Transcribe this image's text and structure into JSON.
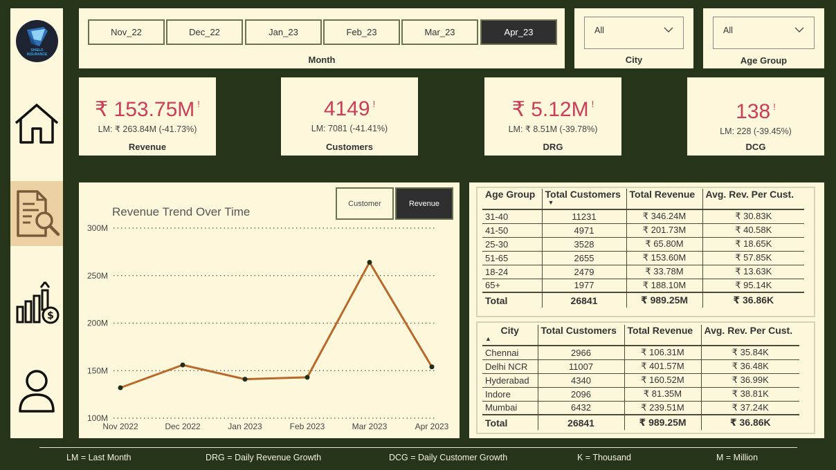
{
  "sidebar": {
    "logo_line1": "SHIELD",
    "logo_line2": "INSURANCE",
    "items": [
      {
        "icon": "home-icon"
      },
      {
        "icon": "report-search-icon",
        "active": true
      },
      {
        "icon": "growth-chart-icon"
      },
      {
        "icon": "user-icon"
      }
    ]
  },
  "month_slicer": {
    "title": "Month",
    "options": [
      "Nov_22",
      "Dec_22",
      "Jan_23",
      "Feb_23",
      "Mar_23",
      "Apr_23"
    ],
    "selected": "Apr_23"
  },
  "city_slicer": {
    "title": "City",
    "value": "All"
  },
  "age_slicer": {
    "title": "Age Group",
    "value": "All"
  },
  "kpis": [
    {
      "value": "₹ 153.75M",
      "flag": "!",
      "lm": "LM: ₹ 263.84M (-41.73%)",
      "name": "Revenue"
    },
    {
      "value": "4149",
      "flag": "!",
      "lm": "LM: 7081 (-41.41%)",
      "name": "Customers"
    },
    {
      "value": "₹ 5.12M",
      "flag": "!",
      "lm": "LM: ₹ 8.51M (-39.78%)",
      "name": "DRG"
    },
    {
      "value": "138",
      "flag": "!",
      "lm": "LM: 228 (-39.45%)",
      "name": "DCG"
    }
  ],
  "chart_toggle": {
    "customer_label": "Customer",
    "revenue_label": "Revenue",
    "selected": "Revenue"
  },
  "chart_data": {
    "type": "line",
    "title": "Revenue Trend Over Time",
    "categories": [
      "Nov 2022",
      "Dec 2022",
      "Jan 2023",
      "Feb 2023",
      "Mar 2023",
      "Apr 2023"
    ],
    "x_positions": [
      0,
      1,
      2,
      3,
      4,
      5
    ],
    "series": [
      {
        "values": [
          132,
          156,
          141,
          143,
          264,
          154
        ]
      }
    ],
    "ylim": [
      100,
      300
    ],
    "yticks": [
      300,
      250,
      200,
      150,
      100
    ],
    "ytick_labels": [
      "300M",
      "250M",
      "200M",
      "150M",
      "100M"
    ],
    "grid": true,
    "line_color": "#b8692a",
    "marker_color": "#1f2e18"
  },
  "age_table": {
    "headers": [
      "Age Group",
      "Total Customers",
      "Total Revenue",
      "Avg. Rev. Per Cust."
    ],
    "sort_indicator": "▼",
    "rows": [
      [
        "31-40",
        "11231",
        "₹ 346.24M",
        "₹ 30.83K"
      ],
      [
        "41-50",
        "4971",
        "₹ 201.73M",
        "₹ 40.58K"
      ],
      [
        "25-30",
        "3528",
        "₹ 65.80M",
        "₹ 18.65K"
      ],
      [
        "51-65",
        "2655",
        "₹ 153.60M",
        "₹ 57.85K"
      ],
      [
        "18-24",
        "2479",
        "₹ 33.78M",
        "₹ 13.63K"
      ],
      [
        "65+",
        "1977",
        "₹ 188.10M",
        "₹ 95.14K"
      ]
    ],
    "total": [
      "Total",
      "26841",
      "₹ 989.25M",
      "₹ 36.86K"
    ]
  },
  "city_table": {
    "headers": [
      "City",
      "Total Customers",
      "Total Revenue",
      "Avg. Rev. Per Cust."
    ],
    "sort_indicator": "▲",
    "rows": [
      [
        "Chennai",
        "2966",
        "₹ 106.31M",
        "₹ 35.84K"
      ],
      [
        "Delhi NCR",
        "11007",
        "₹ 401.57M",
        "₹ 36.48K"
      ],
      [
        "Hyderabad",
        "4340",
        "₹ 160.52M",
        "₹ 36.99K"
      ],
      [
        "Indore",
        "2096",
        "₹ 81.35M",
        "₹ 38.81K"
      ],
      [
        "Mumbai",
        "6432",
        "₹ 239.51M",
        "₹ 37.24K"
      ]
    ],
    "total": [
      "Total",
      "26841",
      "₹ 989.25M",
      "₹ 36.86K"
    ]
  },
  "footer": [
    "LM = Last Month",
    "DRG = Daily Revenue Growth",
    "DCG = Daily Customer Growth",
    "K = Thousand",
    "M = Million"
  ]
}
